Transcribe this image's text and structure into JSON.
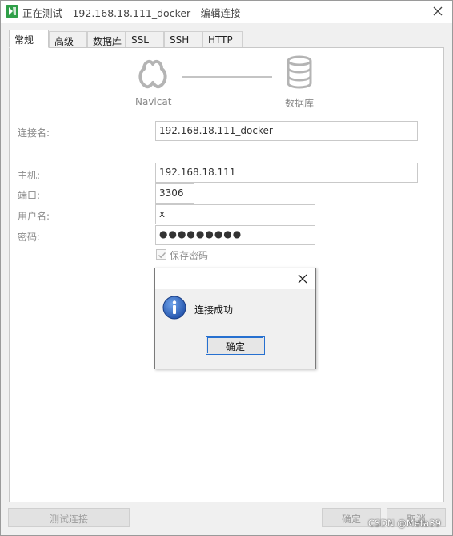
{
  "window": {
    "title": "正在测试 - 192.168.18.111_docker - 编辑连接"
  },
  "tabs": [
    {
      "label": "常规",
      "active": true
    },
    {
      "label": "高级",
      "active": false
    },
    {
      "label": "数据库",
      "active": false
    },
    {
      "label": "SSL",
      "active": false
    },
    {
      "label": "SSH",
      "active": false
    },
    {
      "label": "HTTP",
      "active": false
    }
  ],
  "illustration": {
    "client_label": "Navicat",
    "server_label": "数据库"
  },
  "form": {
    "connection_name_label": "连接名:",
    "connection_name_value": "192.168.18.111_docker",
    "host_label": "主机:",
    "host_value": "192.168.18.111",
    "port_label": "端口:",
    "port_value": "3306",
    "username_label": "用户名:",
    "username_value": "x",
    "password_label": "密码:",
    "password_value": "●●●●●●●●●",
    "save_password_label": "保存密码",
    "save_password_checked": true
  },
  "dialog": {
    "message": "连接成功",
    "ok_label": "确定",
    "icon": "info-icon"
  },
  "footer": {
    "test_connection_label": "测试连接",
    "ok_label": "确定",
    "cancel_label": "取消"
  },
  "watermark": "CSDN @Meta39",
  "colors": {
    "app_icon": "#2f9f48",
    "info_icon": "#2a5fb5",
    "dialog_focus": "#2670d0"
  }
}
